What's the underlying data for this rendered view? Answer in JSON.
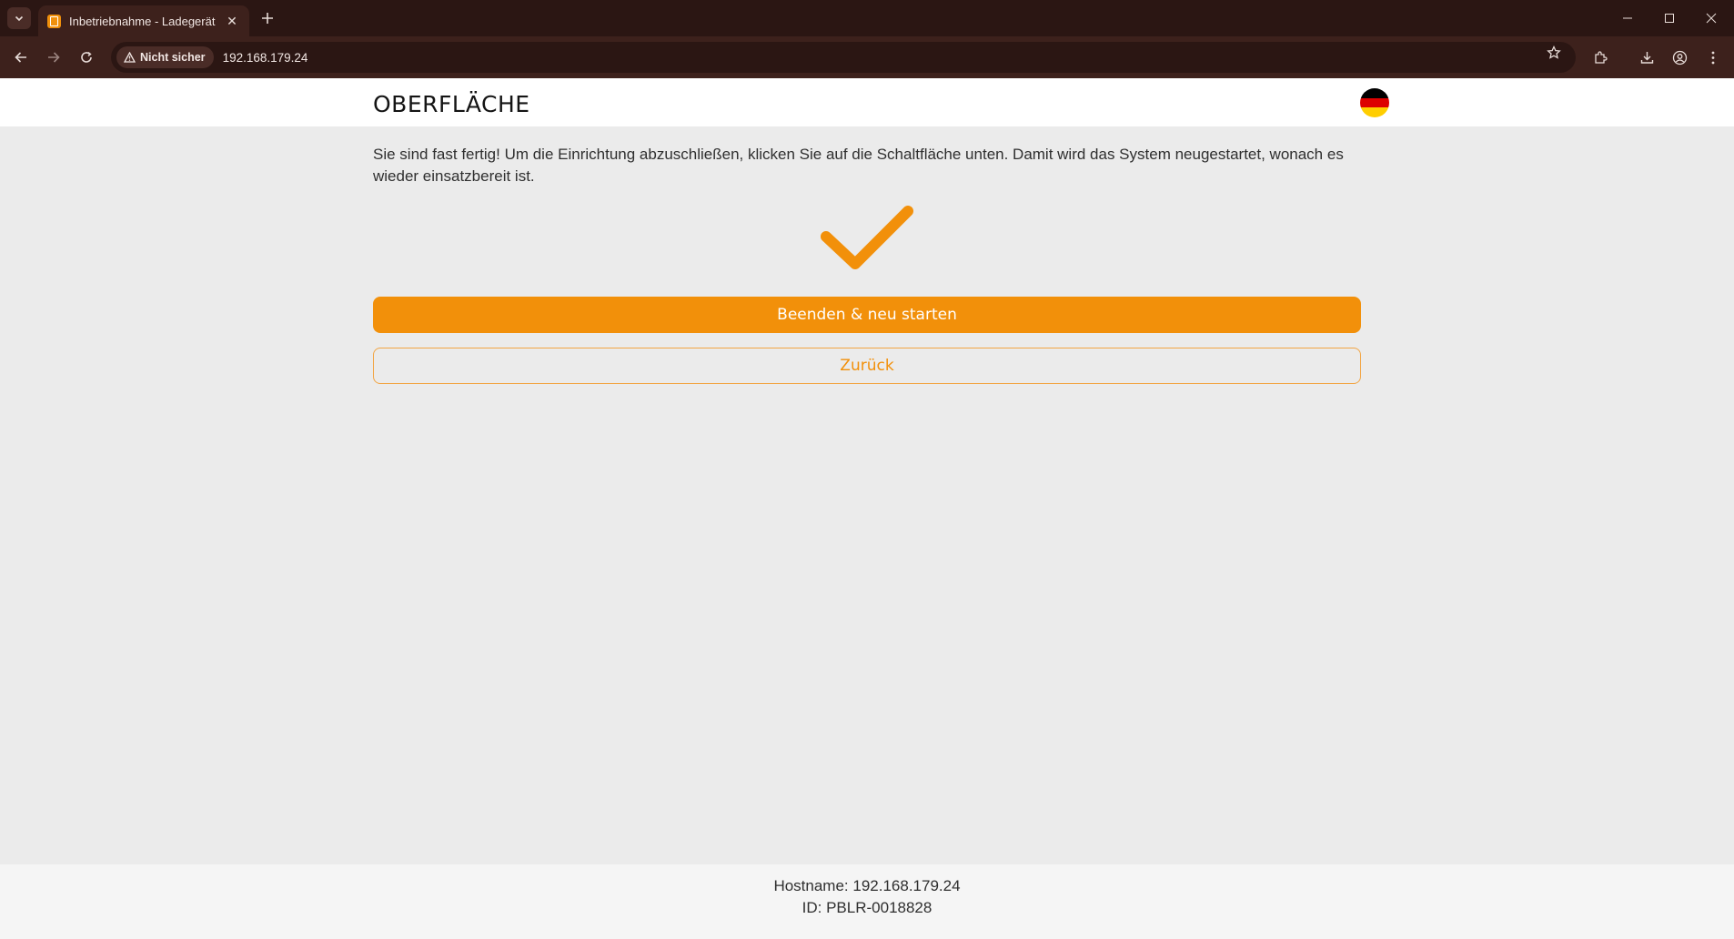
{
  "browser": {
    "tab": {
      "title": "Inbetriebnahme - Ladegerät",
      "favicon": "document-icon"
    },
    "address": {
      "security_label": "Nicht sicher",
      "url": "192.168.179.24"
    }
  },
  "header": {
    "brand": "OBERFLÄCHE",
    "language_flag": "germany-flag-icon"
  },
  "main": {
    "intro_text": "Sie sind fast fertig! Um die Einrichtung abzuschließen, klicken Sie auf die Schaltfläche unten. Damit wird das System neugestartet, wonach es wieder einsatzbereit ist.",
    "success_icon": "checkmark-icon",
    "finish_button": "Beenden & neu starten",
    "back_button": "Zurück"
  },
  "footer": {
    "hostname_line": "Hostname: 192.168.179.24",
    "id_line": "ID: PBLR-0018828"
  },
  "colors": {
    "accent": "#f2900a",
    "browser_frame": "#2b1613",
    "browser_toolbar": "#3d211c",
    "page_background": "#ebebeb",
    "header_background": "#ffffff",
    "flag_black": "#000000",
    "flag_red": "#dd0000",
    "flag_gold": "#ffce00"
  }
}
